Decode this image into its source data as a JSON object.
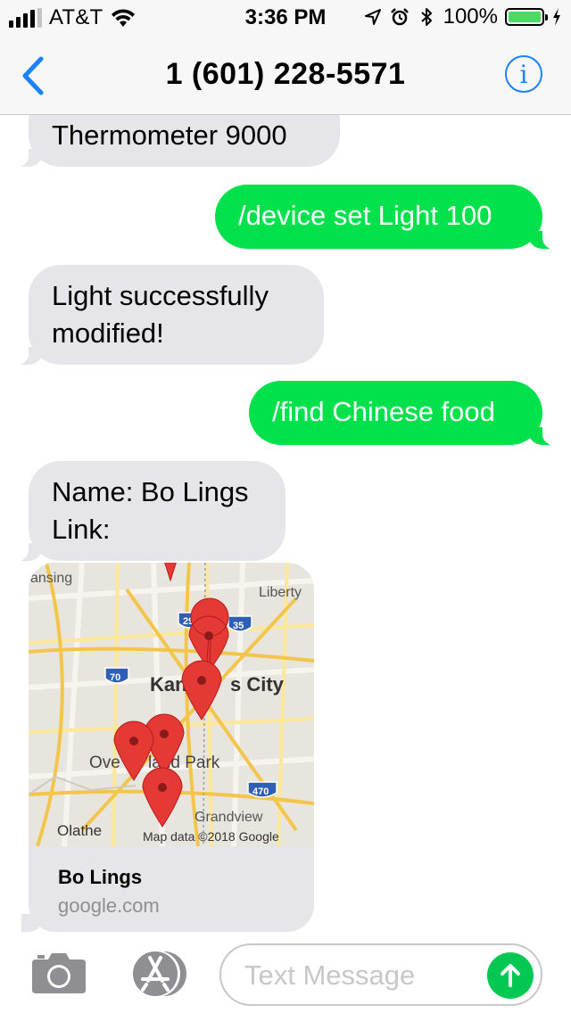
{
  "status_bar": {
    "carrier": "AT&T",
    "time": "3:36 PM",
    "battery": "100%",
    "icons": [
      "signal-icon",
      "wifi-icon",
      "location-icon",
      "alarm-icon",
      "bluetooth-icon",
      "battery-icon",
      "charging-icon"
    ]
  },
  "nav": {
    "title": "1 (601) 228-5571",
    "back_icon": "chevron-left-icon",
    "info_icon": "info-icon",
    "info_glyph": "i"
  },
  "messages": [
    {
      "from": "them",
      "lines": [
        "Thermometer 9000"
      ]
    },
    {
      "from": "me",
      "lines": [
        "/device set Light 100"
      ]
    },
    {
      "from": "them",
      "lines": [
        "Light successfully",
        "modified!"
      ]
    },
    {
      "from": "me",
      "lines": [
        "/find Chinese food"
      ]
    },
    {
      "from": "them",
      "lines": [
        "Name: Bo Lings",
        "Link:"
      ]
    }
  ],
  "link_preview": {
    "title": "Bo Lings",
    "domain": "google.com",
    "map": {
      "labels": [
        "ansing",
        "Liberty",
        "Kan",
        "s City",
        "Ove",
        "land Park",
        "Grandview",
        "Olathe"
      ],
      "shields": [
        "29",
        "35",
        "70",
        "470"
      ],
      "attribution": "Map data ©2018 Google",
      "pin_count": 6
    }
  },
  "input_bar": {
    "placeholder": "Text Message",
    "value": "",
    "icons": [
      "camera-icon",
      "app-store-icon",
      "send-arrow-icon"
    ]
  },
  "colors": {
    "sent_bubble": "#00e14b",
    "received_bubble": "#e5e5ea",
    "accent": "#1a82fb",
    "send_button": "#00c853",
    "map_pin": "#e53935"
  }
}
